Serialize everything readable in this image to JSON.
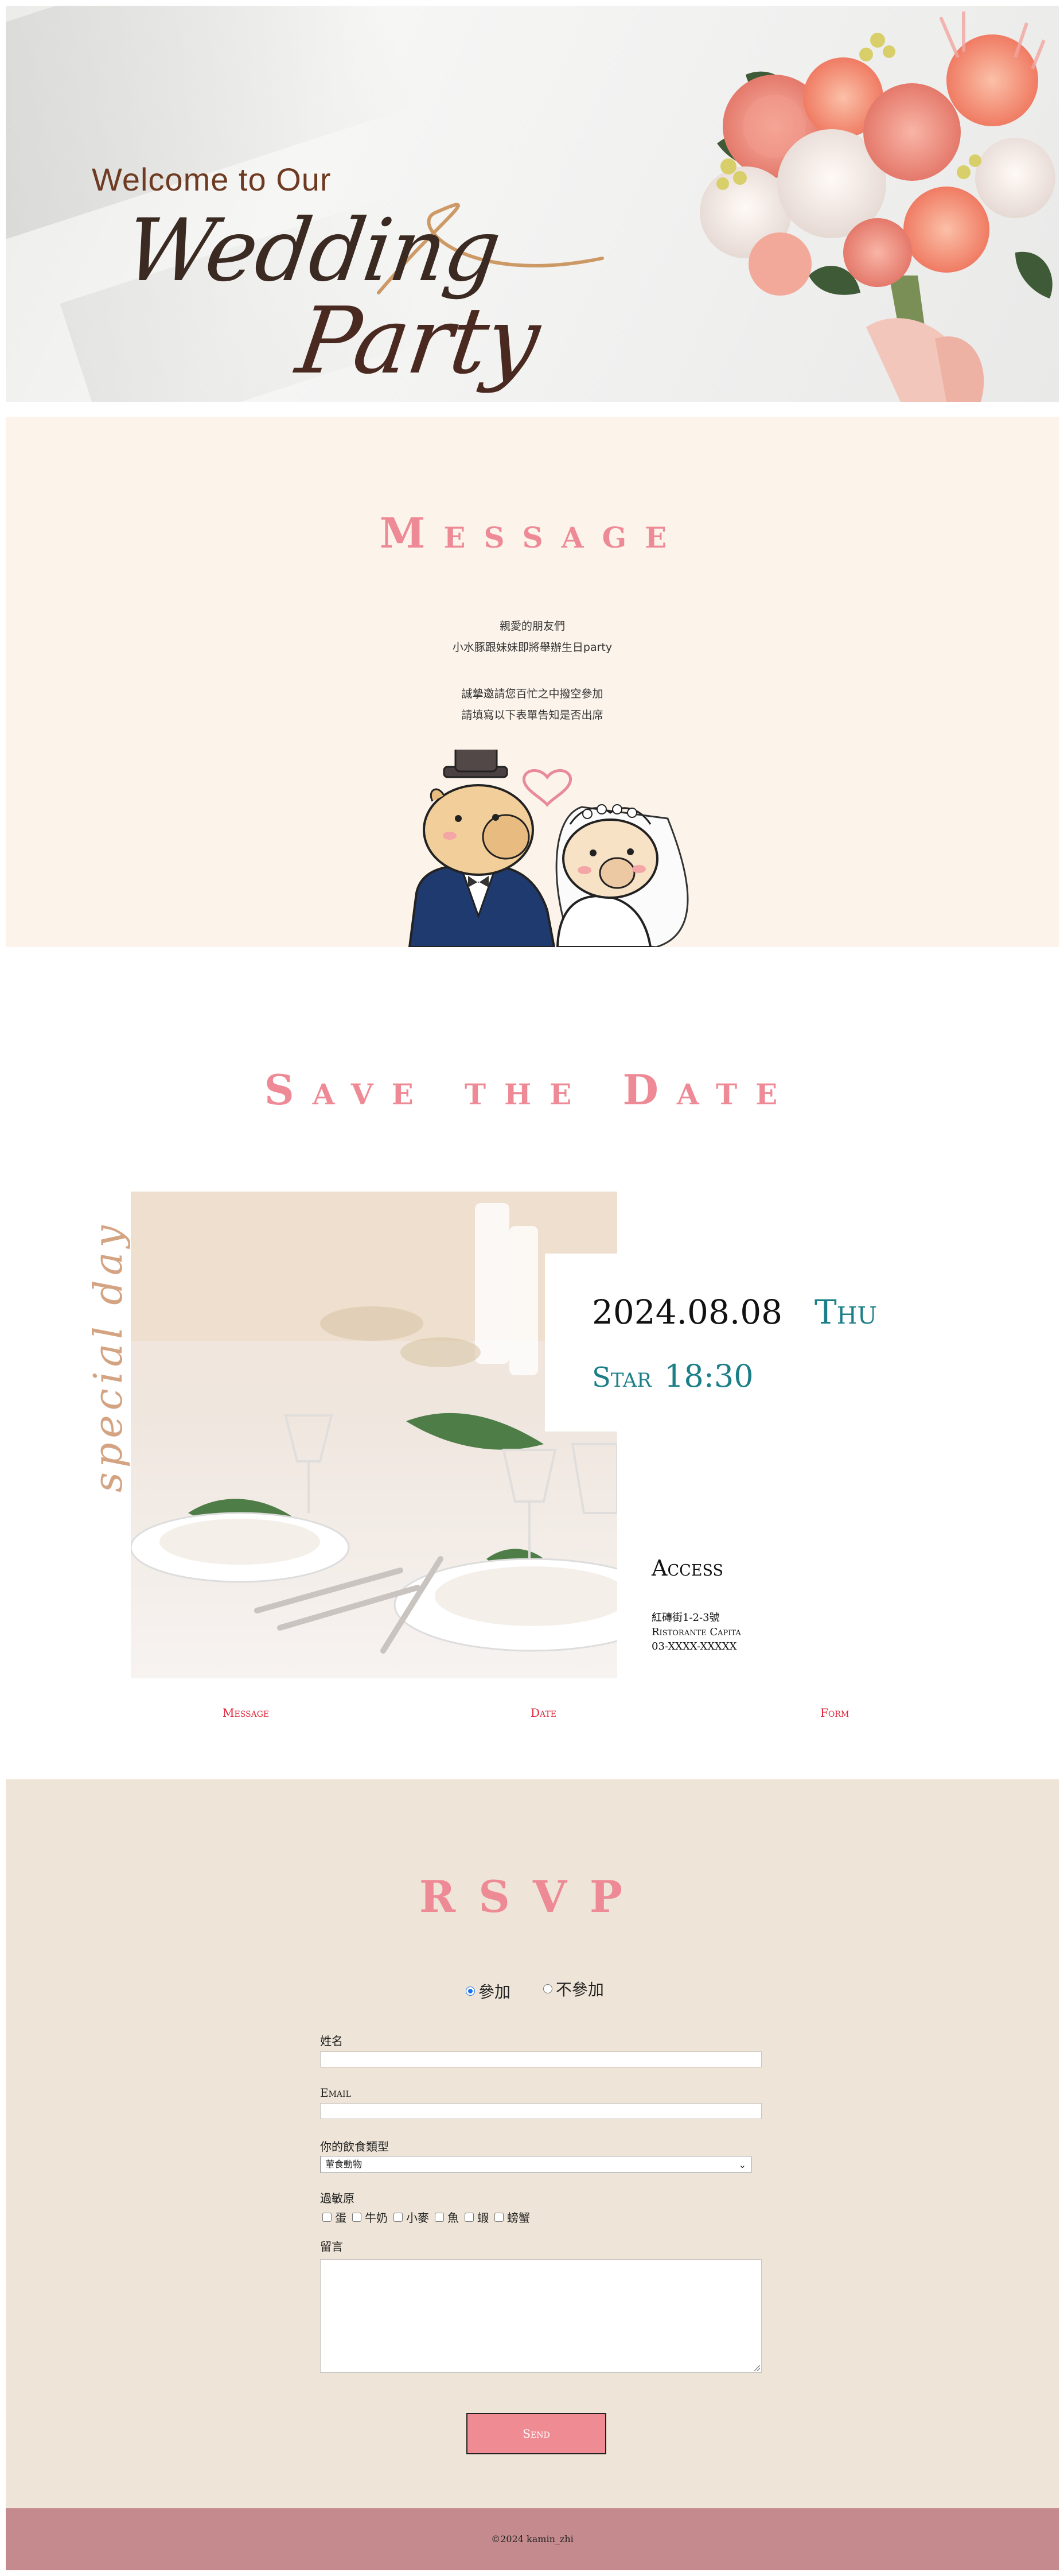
{
  "hero": {
    "welcome": "Welcome to Our",
    "wedding": "Wedding",
    "party": "Party"
  },
  "message": {
    "title": "Message",
    "lines": [
      "親愛的朋友們",
      "小水豚跟妹妹即將舉辦生日party"
    ],
    "lines2": [
      "誠摯邀請您百忙之中撥空參加",
      "請填寫以下表單告知是否出席"
    ]
  },
  "save_the_date": {
    "title": "Save the Date",
    "script_text": "special day",
    "date": "2024.08.08",
    "weekday": "Thu",
    "start_label": "Star",
    "start_time": "18:30",
    "access_title": "Access",
    "access_address": "紅磚街1-2-3號",
    "access_venue": "Ristorante Capita",
    "access_phone": "03-XXXX-XXXXX"
  },
  "nav": {
    "message": "Message",
    "date": "Date",
    "form": "Form"
  },
  "rsvp": {
    "title": "RSVP",
    "attend": "參加",
    "not_attend": "不參加",
    "name_label": "姓名",
    "email_label": "Email",
    "diet_label": "你的飲食類型",
    "diet_selected": "葷食動物",
    "allergy_label": "過敏原",
    "allergies": [
      "蛋",
      "牛奶",
      "小麥",
      "魚",
      "蝦",
      "螃蟹"
    ],
    "comment_label": "留言",
    "send": "Send"
  },
  "footer": {
    "copyright": "©2024 kamin_zhi"
  },
  "colors": {
    "pink_title": "#ee8a95",
    "teal": "#1c7f88",
    "nav_red": "#e0283c",
    "message_bg": "#fcf4eb",
    "rsvp_bg": "#eee5d8",
    "footer_bg": "#c48a8d",
    "button_bg": "#ef8b93"
  },
  "icons": [
    "heart-icon",
    "radio-icon",
    "checkbox-icon",
    "chevron-down-icon",
    "resize-grip-icon"
  ]
}
